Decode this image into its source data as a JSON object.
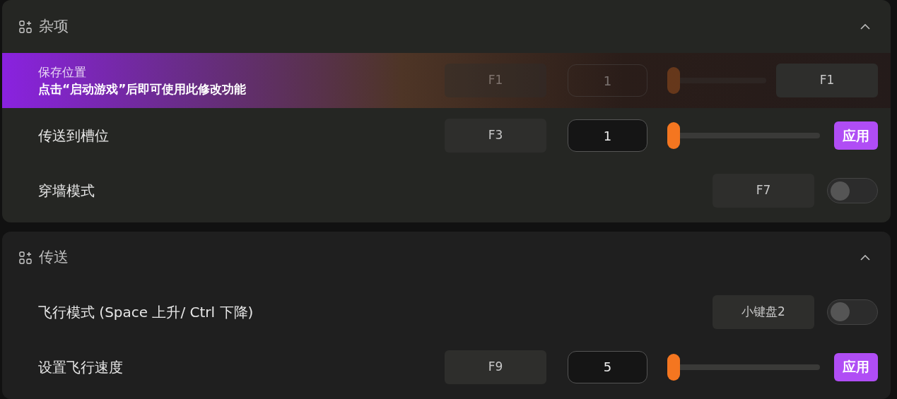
{
  "sections": [
    {
      "title": "杂项",
      "expanded": true,
      "rows": [
        {
          "kind": "notice",
          "label": "保存位置",
          "notice": "点击“启动游戏”后即可使用此修改功能",
          "hotkey": "F1",
          "value": "1",
          "level": 0,
          "key": "F1"
        },
        {
          "kind": "slider",
          "label": "传送到槽位",
          "hotkey": "F3",
          "value": "1",
          "level": 0,
          "button": "应用"
        },
        {
          "kind": "toggle",
          "label": "穿墙模式",
          "hotkey": "F7",
          "on": false
        }
      ]
    },
    {
      "title": "传送",
      "expanded": true,
      "rows": [
        {
          "kind": "toggle",
          "label": "飞行模式 (Space 上升/ Ctrl 下降)",
          "hotkey": "小键盘2",
          "on": false
        },
        {
          "kind": "slider",
          "label": "设置飞行速度",
          "hotkey": "F9",
          "value": "5",
          "level": 0,
          "button": "应用"
        }
      ]
    }
  ]
}
